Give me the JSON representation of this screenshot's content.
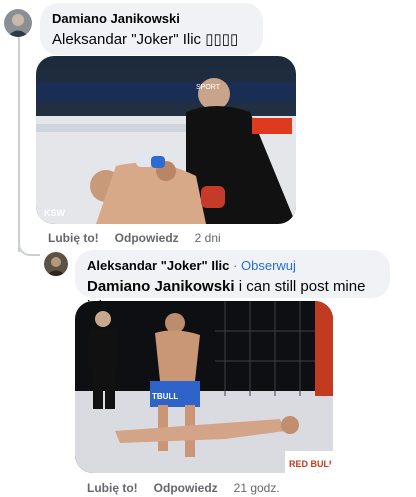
{
  "comments": [
    {
      "author": "Damiano Janikowski",
      "text": "Aleksandar \"Joker\" Ilic ▯▯▯▯",
      "actions": {
        "like": "Lubię to!",
        "reply": "Odpowiedz",
        "time": "2 dni"
      }
    },
    {
      "author": "Aleksandar \"Joker\" Ilic",
      "follow_separator": "·",
      "follow": "Obserwuj",
      "mention": "Damiano Janikowski",
      "text": "i can still post mine job",
      "actions": {
        "like": "Lubię to!",
        "reply": "Odpowiedz",
        "time": "21 godz."
      }
    }
  ],
  "media_text": {
    "broadcast_logo": "SPORT",
    "watermark": "KSW",
    "sponsor_banner": "TBULL",
    "corner_logo": "RED BULL"
  },
  "colors": {
    "bubble": "#f0f2f5",
    "link": "#216fdb",
    "muted": "#65676b",
    "thread": "#ccd0d5"
  }
}
